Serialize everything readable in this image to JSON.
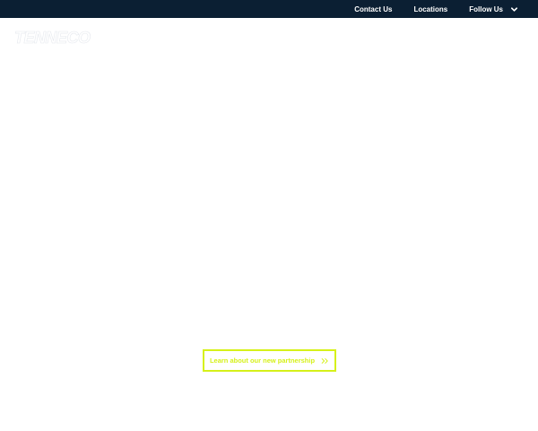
{
  "header": {
    "brand": "TENNECO",
    "nav": [
      {
        "label": "Contact Us"
      },
      {
        "label": "Locations"
      },
      {
        "label": "Follow Us"
      }
    ]
  },
  "hero": {
    "cta_label": "Learn about our new partnership"
  },
  "colors": {
    "topbar": "#0b1f33",
    "accent": "#d6f11a",
    "logo": "#ffffff"
  },
  "icons": {
    "follow_chevron": "chevron-down-icon",
    "cta_arrow": "double-chevron-right-icon"
  }
}
